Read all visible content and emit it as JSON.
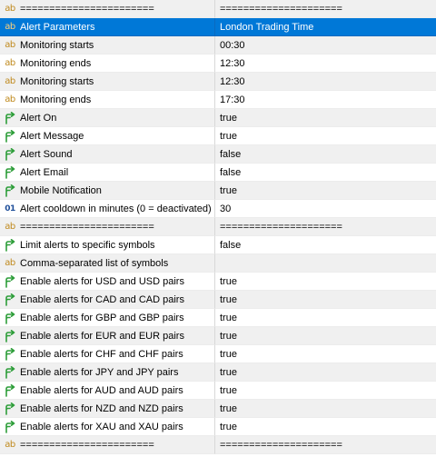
{
  "rows": [
    {
      "icon": "ab",
      "name": "=======================",
      "value": "=====================",
      "bg": "alt"
    },
    {
      "icon": "ab",
      "name": "Alert Parameters",
      "value": "London Trading Time",
      "bg": "selected"
    },
    {
      "icon": "ab",
      "name": "Monitoring starts",
      "value": "00:30",
      "bg": "alt"
    },
    {
      "icon": "ab",
      "name": "Monitoring ends",
      "value": "12:30",
      "bg": "white"
    },
    {
      "icon": "ab",
      "name": "Monitoring starts",
      "value": "12:30",
      "bg": "alt"
    },
    {
      "icon": "ab",
      "name": "Monitoring ends",
      "value": "17:30",
      "bg": "white"
    },
    {
      "icon": "bool",
      "name": "Alert On",
      "value": "true",
      "bg": "alt"
    },
    {
      "icon": "bool",
      "name": "Alert Message",
      "value": "true",
      "bg": "white"
    },
    {
      "icon": "bool",
      "name": "Alert Sound",
      "value": "false",
      "bg": "alt"
    },
    {
      "icon": "bool",
      "name": "Alert Email",
      "value": "false",
      "bg": "white"
    },
    {
      "icon": "bool",
      "name": "Mobile Notification",
      "value": "true",
      "bg": "alt"
    },
    {
      "icon": "int",
      "name": "Alert cooldown in minutes (0 = deactivated)",
      "value": "30",
      "bg": "white"
    },
    {
      "icon": "ab",
      "name": "=======================",
      "value": "=====================",
      "bg": "alt"
    },
    {
      "icon": "bool",
      "name": "Limit alerts to specific symbols",
      "value": "false",
      "bg": "white"
    },
    {
      "icon": "ab",
      "name": "Comma-separated list of symbols",
      "value": "",
      "bg": "alt"
    },
    {
      "icon": "bool",
      "name": "Enable alerts for USD and USD pairs",
      "value": "true",
      "bg": "white"
    },
    {
      "icon": "bool",
      "name": "Enable alerts for CAD and CAD pairs",
      "value": "true",
      "bg": "alt"
    },
    {
      "icon": "bool",
      "name": "Enable alerts for GBP and GBP pairs",
      "value": "true",
      "bg": "white"
    },
    {
      "icon": "bool",
      "name": "Enable alerts for EUR and EUR pairs",
      "value": "true",
      "bg": "alt"
    },
    {
      "icon": "bool",
      "name": "Enable alerts for CHF and CHF pairs",
      "value": "true",
      "bg": "white"
    },
    {
      "icon": "bool",
      "name": "Enable alerts for JPY and JPY pairs",
      "value": "true",
      "bg": "alt"
    },
    {
      "icon": "bool",
      "name": "Enable alerts for AUD and AUD pairs",
      "value": "true",
      "bg": "white"
    },
    {
      "icon": "bool",
      "name": "Enable alerts for NZD and NZD pairs",
      "value": "true",
      "bg": "alt"
    },
    {
      "icon": "bool",
      "name": "Enable alerts for XAU and XAU pairs",
      "value": "true",
      "bg": "white"
    },
    {
      "icon": "ab",
      "name": "=======================",
      "value": "=====================",
      "bg": "alt"
    }
  ],
  "icon_glyphs": {
    "ab": "ab",
    "int": "01"
  },
  "colors": {
    "selected": "#0078d7",
    "string_icon": "#c08a1e",
    "bool_icon": "#2e9e3a",
    "int_icon": "#1f4f9a"
  }
}
